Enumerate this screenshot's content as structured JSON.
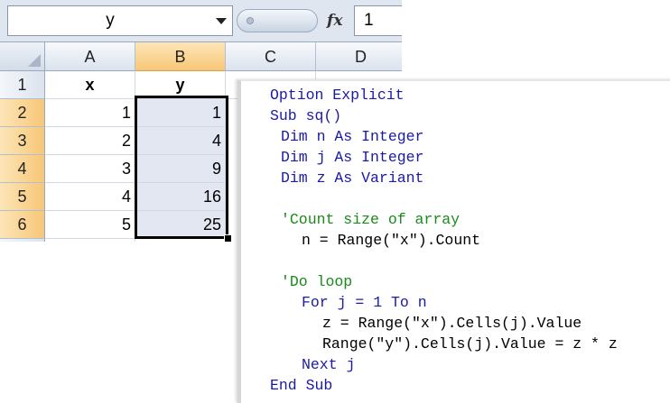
{
  "formula_bar": {
    "name_box": "y",
    "fx_label": "fx",
    "value": "1"
  },
  "columns": [
    "A",
    "B",
    "C",
    "D"
  ],
  "rows": [
    "1",
    "2",
    "3",
    "4",
    "5",
    "6"
  ],
  "headers": {
    "a": "x",
    "b": "y"
  },
  "data": [
    {
      "x": "1",
      "y": "1"
    },
    {
      "x": "2",
      "y": "4"
    },
    {
      "x": "3",
      "y": "9"
    },
    {
      "x": "4",
      "y": "16"
    },
    {
      "x": "5",
      "y": "25"
    }
  ],
  "code": [
    {
      "text": "Option Explicit",
      "kind": "kw",
      "indent": 0
    },
    {
      "text": "Sub sq()",
      "kind": "kw",
      "indent": 0
    },
    {
      "text": "Dim n As Integer",
      "kind": "kw",
      "indent": 1
    },
    {
      "text": "Dim j As Integer",
      "kind": "kw",
      "indent": 1
    },
    {
      "text": "Dim z As Variant",
      "kind": "kw",
      "indent": 1
    },
    {
      "text": "",
      "kind": "tx",
      "indent": 0
    },
    {
      "text": "'Count size of array",
      "kind": "cm",
      "indent": 1
    },
    {
      "text": "n = Range(\"x\").Count",
      "kind": "tx",
      "indent": 2
    },
    {
      "text": "",
      "kind": "tx",
      "indent": 0
    },
    {
      "text": "'Do loop",
      "kind": "cm",
      "indent": 1
    },
    {
      "text": "For j = 1 To n",
      "kind": "kw",
      "indent": 2
    },
    {
      "text": "z = Range(\"x\").Cells(j).Value",
      "kind": "tx",
      "indent": 3
    },
    {
      "text": "Range(\"y\").Cells(j).Value = z * z",
      "kind": "tx",
      "indent": 3
    },
    {
      "text": "Next j",
      "kind": "kw",
      "indent": 2
    },
    {
      "text": "End Sub",
      "kind": "kw",
      "indent": 0
    }
  ]
}
